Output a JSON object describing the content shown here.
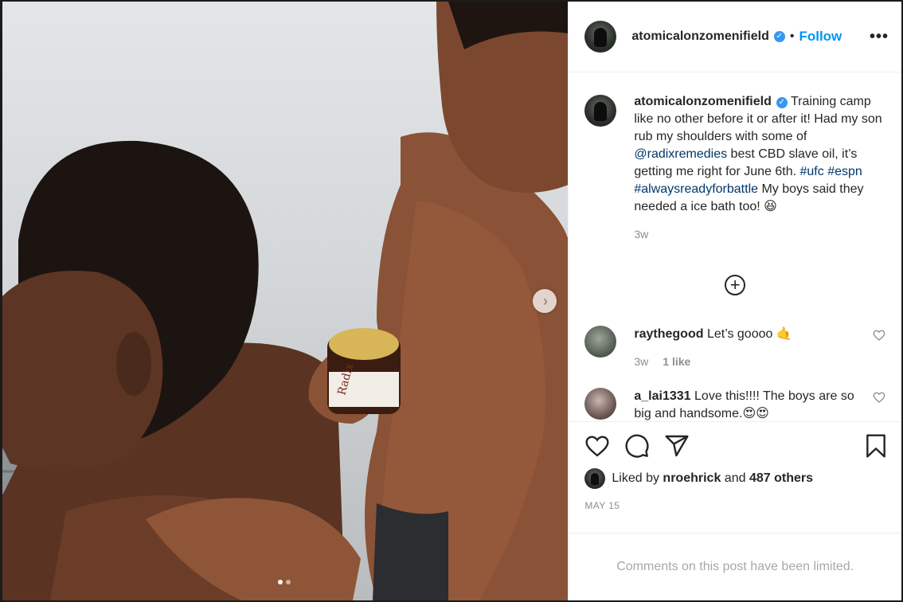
{
  "post": {
    "username": "atomicalonzomenifield",
    "verified_glyph": "✓",
    "bullet": "•",
    "follow_label": "Follow",
    "more_label": "•••",
    "caption": {
      "part1": " Training camp like no other before it or after it! Had my son rub my shoulders with some of ",
      "mention": "@radixremedies",
      "part2": " best CBD slave oil, it’s getting me right for June 6th. ",
      "tag1": "#ufc",
      "tag2": "#espn",
      "tag3": "#alwaysreadyforbattle",
      "part3": " My boys said they needed a ice bath too! 😆",
      "time": "3w"
    },
    "load_more_glyph": "+"
  },
  "comments": [
    {
      "username": "raythegood",
      "text": "Let’s goooo 🤙",
      "time": "3w",
      "likes": "1 like"
    },
    {
      "username": "a_lai1331",
      "text": "Love this!!!! The boys are so big and handsome.😍😍"
    }
  ],
  "actions": {
    "liked_by_prefix": "Liked by",
    "liked_by_user": "nroehrick",
    "and": "and",
    "others": "487 others",
    "date": "MAY 15"
  },
  "footer": {
    "limited_text": "Comments on this post have been limited."
  },
  "carousel": {
    "next_glyph": "›",
    "slide_index": 1,
    "slide_count": 2
  },
  "icons": [
    "heart-icon",
    "comment-icon",
    "share-icon",
    "bookmark-icon",
    "more-icon",
    "plus-circle-icon",
    "verified-icon",
    "chevron-right-icon"
  ],
  "colors": {
    "link": "#00376b",
    "follow": "#0095f6",
    "verified": "#3897f0",
    "muted": "#8e8e8e",
    "text": "#262626"
  }
}
